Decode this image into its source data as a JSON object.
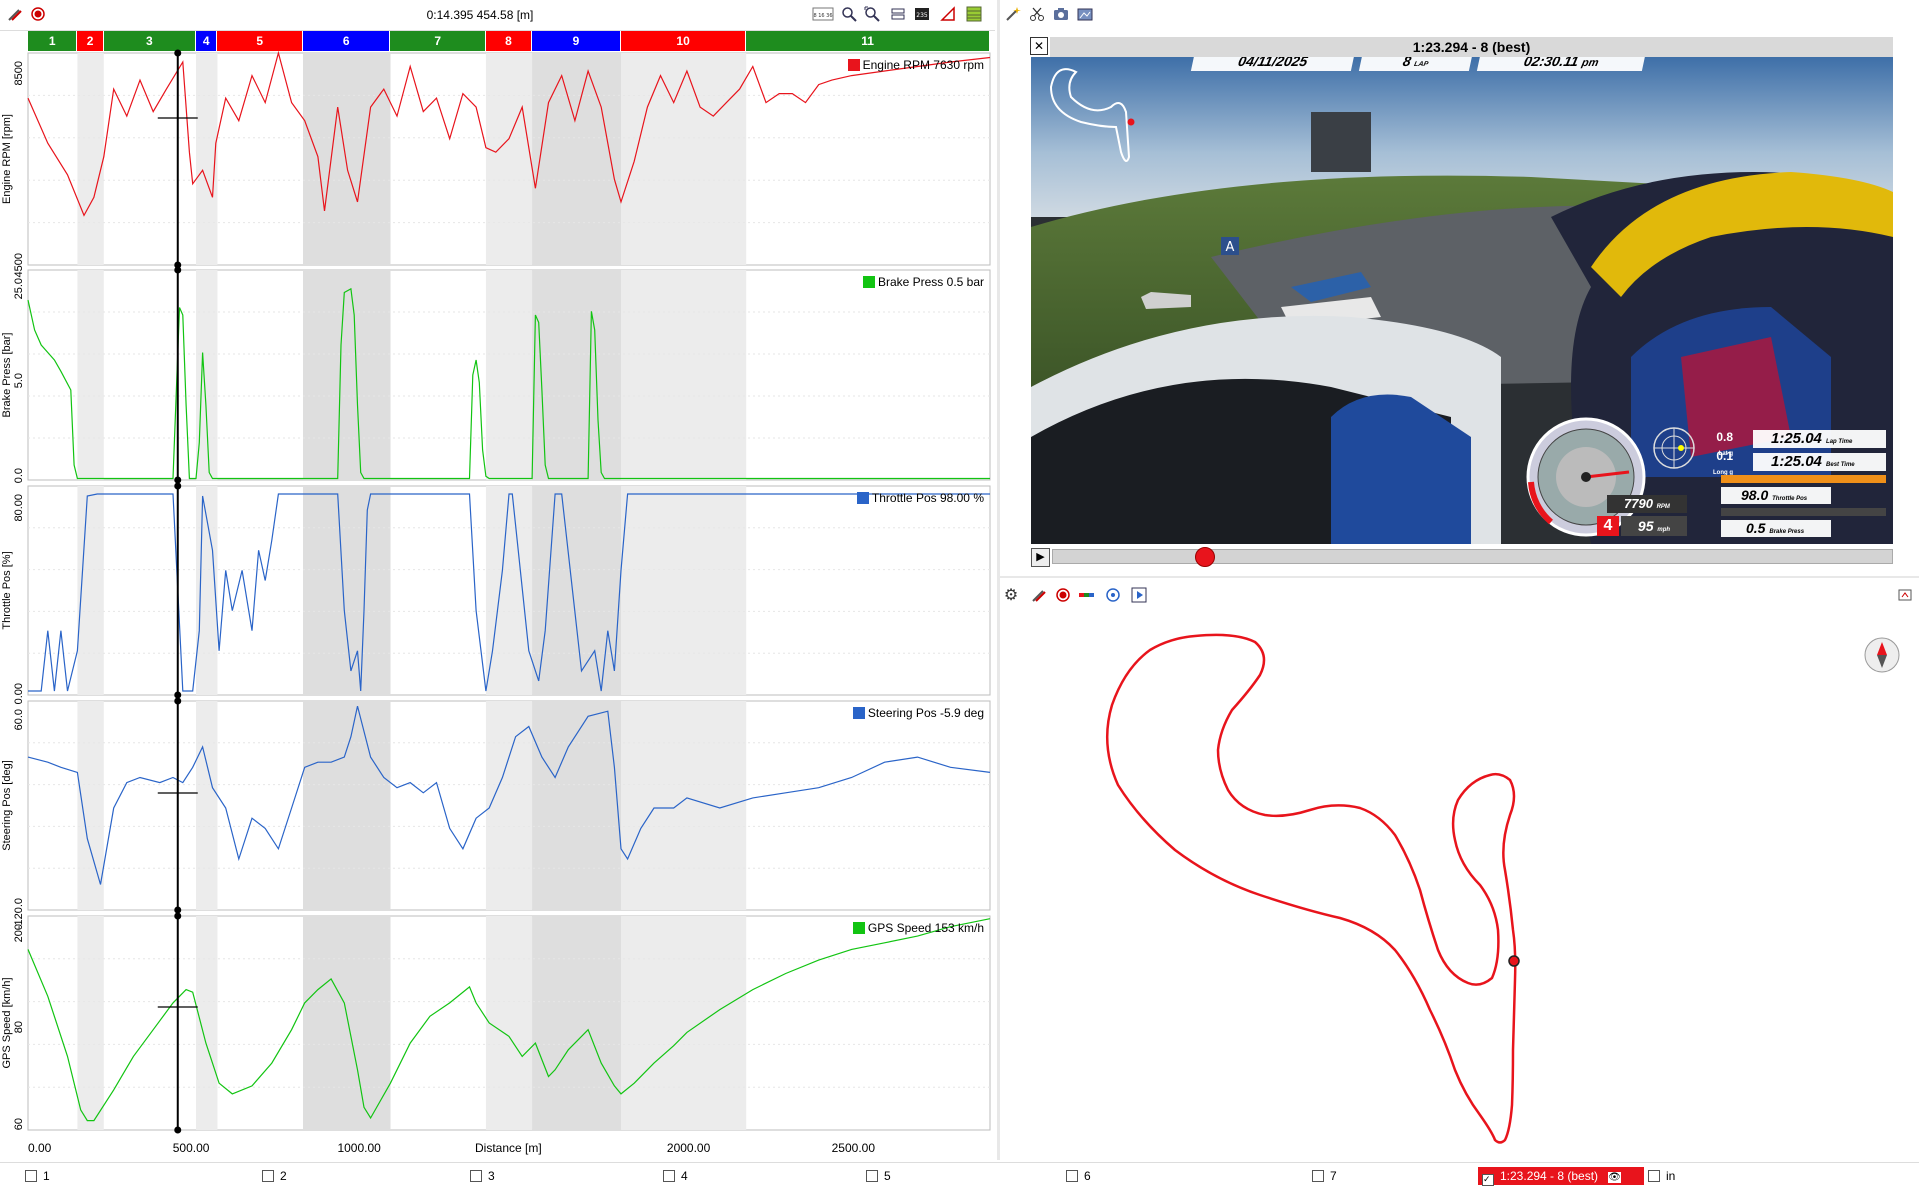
{
  "toolbar": {
    "cursor_readout": "0:14.395 454.58 [m]",
    "icons": [
      "tools-icon",
      "record-icon",
      "time-format-icon",
      "zoom-in-icon",
      "zoom-fit-icon",
      "layout-icon",
      "channels-icon",
      "marker-icon",
      "grid-icon"
    ],
    "time_format_label": "8 16 36",
    "channels_badge": "235"
  },
  "sectors": [
    {
      "label": "1",
      "color": "#1e8c1e"
    },
    {
      "label": "2",
      "color": "#ff0000"
    },
    {
      "label": "3",
      "color": "#1e8c1e"
    },
    {
      "label": "4",
      "color": "#0000ff"
    },
    {
      "label": "5",
      "color": "#ff0000"
    },
    {
      "label": "6",
      "color": "#0000ff"
    },
    {
      "label": "7",
      "color": "#1e8c1e"
    },
    {
      "label": "8",
      "color": "#ff0000"
    },
    {
      "label": "9",
      "color": "#0000ff"
    },
    {
      "label": "10",
      "color": "#ff0000"
    },
    {
      "label": "11",
      "color": "#1e8c1e"
    }
  ],
  "channels": [
    {
      "name": "Engine RPM",
      "value": "7630",
      "unit": "rpm",
      "ylabel": "Engine RPM [rpm]",
      "ticks": [
        "8500",
        "4500"
      ],
      "color": "#e8141c"
    },
    {
      "name": "Brake Press",
      "value": "0.5",
      "unit": "bar",
      "ylabel": "Brake Press [bar]",
      "ticks": [
        "25.0",
        "5.0",
        "0.0"
      ],
      "color": "#12c412"
    },
    {
      "name": "Throttle Pos",
      "value": "98.00",
      "unit": "%",
      "ylabel": "Throttle Pos [%]",
      "ticks": [
        "80.00",
        "0.00"
      ],
      "color": "#2a64c8"
    },
    {
      "name": "Steering Pos",
      "value": "-5.9",
      "unit": "deg",
      "ylabel": "Steering Pos [deg]",
      "ticks": [
        "60.0",
        "-120.0"
      ],
      "color": "#2a64c8"
    },
    {
      "name": "GPS Speed",
      "value": "153",
      "unit": "km/h",
      "ylabel": "GPS Speed [km/h]",
      "ticks": [
        "200",
        "80",
        "60"
      ],
      "color": "#12c412"
    }
  ],
  "x_axis": {
    "label": "Distance [m]",
    "ticks": [
      "0.00",
      "500.00",
      "1000.00",
      "2000.00",
      "2500.00"
    ]
  },
  "video": {
    "title": "1:23.294 - 8 (best)",
    "date": "04/11/2025",
    "lap_number": "8",
    "lap_word": "LAP",
    "clock": "02:30.11",
    "clock_suffix": "pm",
    "lap_time": "1:25.04",
    "lap_time_label": "Lap Time",
    "best_time": "1:25.04",
    "best_time_label": "Best Time",
    "lat_g": "0.8",
    "lat_label": "Lat g",
    "long_g": "0.1",
    "long_label": "Long g",
    "throttle": "98.0",
    "throttle_label": "Throttle Pos",
    "brake": "0.5",
    "brake_label": "Brake Press",
    "rpm": "7790",
    "rpm_unit": "RPM",
    "gear": "4",
    "speed": "95",
    "speed_unit": "mph",
    "track_sign": "A",
    "close_label": "✕",
    "play_label": "▶",
    "scrub_fraction": 0.18
  },
  "map_toolbar": {
    "icons": [
      "gear-icon",
      "tools-icon",
      "record-icon",
      "color-bar-icon",
      "target-icon",
      "play-icon",
      "export-icon"
    ]
  },
  "footer": {
    "slots": [
      "1",
      "2",
      "3",
      "4",
      "5",
      "6",
      "7"
    ],
    "active_lap": "1:23.294 - 8 (best)",
    "last_slot": "in"
  },
  "chart_data": [
    {
      "type": "line",
      "title": "Engine RPM",
      "ylabel": "Engine RPM [rpm]",
      "xlabel": "Distance [m]",
      "xlim": [
        0,
        2920
      ],
      "ylim": [
        4200,
        8900
      ],
      "x": [
        0,
        60,
        120,
        170,
        200,
        230,
        260,
        300,
        340,
        380,
        420,
        470,
        490,
        500,
        530,
        560,
        570,
        600,
        640,
        680,
        720,
        760,
        800,
        840,
        880,
        900,
        940,
        970,
        1000,
        1040,
        1080,
        1120,
        1160,
        1200,
        1240,
        1280,
        1320,
        1360,
        1390,
        1420,
        1460,
        1500,
        1540,
        1580,
        1620,
        1660,
        1700,
        1740,
        1780,
        1800,
        1840,
        1880,
        1920,
        1960,
        2000,
        2040,
        2080,
        2120,
        2160,
        2200,
        2240,
        2280,
        2320,
        2360,
        2400,
        2440,
        2500,
        2600,
        2700,
        2800,
        2920
      ],
      "values": [
        7900,
        6900,
        6200,
        5300,
        5700,
        6600,
        8100,
        7500,
        8300,
        7600,
        8100,
        8700,
        6700,
        6000,
        6300,
        5700,
        6900,
        7900,
        7400,
        8400,
        7800,
        8900,
        7800,
        7400,
        6600,
        5400,
        7700,
        6300,
        5600,
        7700,
        8100,
        7500,
        8600,
        7600,
        7900,
        7000,
        8000,
        7700,
        6800,
        6700,
        7000,
        7700,
        5900,
        7800,
        8400,
        7400,
        8500,
        7700,
        6100,
        5600,
        6500,
        7700,
        8400,
        7800,
        8500,
        7700,
        7500,
        7800,
        8100,
        8600,
        7800,
        8000,
        8000,
        7800,
        8200,
        8300,
        8400,
        8500,
        8600,
        8700,
        8800
      ]
    },
    {
      "type": "line",
      "title": "Brake Press",
      "ylabel": "Brake Press [bar]",
      "xlabel": "Distance [m]",
      "xlim": [
        0,
        2920
      ],
      "ylim": [
        0,
        28
      ],
      "x": [
        0,
        20,
        40,
        60,
        80,
        100,
        130,
        140,
        150,
        440,
        460,
        470,
        480,
        490,
        500,
        510,
        520,
        530,
        540,
        550,
        560,
        570,
        580,
        940,
        950,
        960,
        980,
        990,
        1000,
        1010,
        1020,
        1340,
        1350,
        1360,
        1370,
        1380,
        1390,
        1400,
        1530,
        1540,
        1550,
        1560,
        1570,
        1580,
        1700,
        1710,
        1720,
        1730,
        1740,
        1750,
        1760,
        2920
      ],
      "values": [
        24.0,
        20.0,
        18.0,
        17.0,
        16.0,
        14.5,
        12.0,
        2.0,
        0.2,
        0.2,
        23.0,
        22.0,
        10.0,
        0.2,
        0.2,
        0.2,
        5.0,
        17.0,
        10.0,
        1.0,
        0.2,
        0.2,
        0.2,
        0.2,
        18.0,
        25.0,
        25.5,
        22.0,
        10.0,
        1.0,
        0.2,
        0.2,
        14.0,
        16.0,
        13.0,
        4.0,
        0.5,
        0.2,
        0.2,
        22.0,
        21.0,
        12.0,
        2.0,
        0.2,
        0.2,
        22.5,
        20.0,
        8.0,
        1.0,
        0.2,
        0.2,
        0.2
      ]
    },
    {
      "type": "line",
      "title": "Throttle Pos",
      "ylabel": "Throttle Pos [%]",
      "xlabel": "Distance [m]",
      "xlim": [
        0,
        2920
      ],
      "ylim": [
        -2,
        102
      ],
      "x": [
        0,
        40,
        60,
        80,
        100,
        120,
        150,
        180,
        210,
        440,
        470,
        500,
        520,
        530,
        560,
        580,
        600,
        620,
        650,
        680,
        700,
        720,
        740,
        760,
        940,
        960,
        980,
        1000,
        1010,
        1020,
        1030,
        1040,
        1340,
        1360,
        1390,
        1410,
        1440,
        1460,
        1470,
        1520,
        1550,
        1570,
        1600,
        1620,
        1680,
        1720,
        1740,
        1760,
        1780,
        1800,
        1820,
        2920
      ],
      "values": [
        0,
        0,
        30,
        0,
        30,
        0,
        20,
        97,
        98,
        98,
        0,
        0,
        30,
        97,
        70,
        20,
        60,
        40,
        60,
        30,
        70,
        55,
        75,
        98,
        98,
        40,
        10,
        20,
        0,
        40,
        90,
        98,
        98,
        40,
        0,
        20,
        60,
        98,
        98,
        20,
        5,
        30,
        98,
        98,
        10,
        20,
        0,
        30,
        10,
        60,
        98,
        98
      ]
    },
    {
      "type": "line",
      "title": "Steering Pos",
      "ylabel": "Steering Pos [deg]",
      "xlabel": "Distance [m]",
      "xlim": [
        0,
        2920
      ],
      "ylim": [
        -130,
        75
      ],
      "x": [
        0,
        60,
        100,
        150,
        180,
        220,
        260,
        300,
        340,
        400,
        440,
        470,
        500,
        530,
        560,
        600,
        640,
        680,
        720,
        760,
        800,
        840,
        880,
        920,
        960,
        980,
        1000,
        1040,
        1080,
        1120,
        1160,
        1200,
        1240,
        1280,
        1320,
        1360,
        1400,
        1440,
        1480,
        1520,
        1560,
        1600,
        1640,
        1700,
        1760,
        1780,
        1800,
        1820,
        1860,
        1900,
        1960,
        2000,
        2100,
        2200,
        2300,
        2400,
        2500,
        2600,
        2700,
        2800,
        2920
      ],
      "values": [
        20,
        15,
        10,
        5,
        -60,
        -105,
        -30,
        -5,
        0,
        -5,
        0,
        -5,
        10,
        30,
        -10,
        -30,
        -80,
        -40,
        -50,
        -70,
        -30,
        10,
        15,
        15,
        20,
        40,
        70,
        20,
        0,
        -10,
        -5,
        -15,
        -5,
        -50,
        -70,
        -40,
        -30,
        0,
        40,
        50,
        20,
        0,
        30,
        60,
        65,
        10,
        -70,
        -80,
        -50,
        -30,
        -30,
        -20,
        -30,
        -20,
        -15,
        -10,
        0,
        15,
        20,
        10,
        5
      ]
    },
    {
      "type": "line",
      "title": "GPS Speed",
      "ylabel": "GPS Speed [km/h]",
      "xlabel": "Distance [m]",
      "xlim": [
        0,
        2920
      ],
      "ylim": [
        55,
        215
      ],
      "x": [
        0,
        60,
        120,
        160,
        180,
        200,
        260,
        320,
        380,
        440,
        480,
        500,
        540,
        580,
        620,
        680,
        740,
        800,
        840,
        880,
        920,
        960,
        1000,
        1020,
        1040,
        1100,
        1160,
        1220,
        1280,
        1340,
        1360,
        1400,
        1460,
        1500,
        1540,
        1580,
        1600,
        1640,
        1700,
        1740,
        1780,
        1800,
        1840,
        1900,
        1960,
        2000,
        2100,
        2200,
        2300,
        2400,
        2500,
        2600,
        2700,
        2800,
        2920
      ],
      "values": [
        190,
        155,
        110,
        70,
        62,
        62,
        85,
        110,
        130,
        150,
        160,
        158,
        120,
        90,
        82,
        88,
        105,
        130,
        150,
        160,
        168,
        150,
        100,
        72,
        64,
        90,
        120,
        140,
        150,
        162,
        150,
        135,
        125,
        110,
        120,
        95,
        100,
        115,
        130,
        105,
        88,
        82,
        90,
        105,
        118,
        128,
        145,
        160,
        172,
        182,
        190,
        195,
        200,
        207,
        213
      ]
    }
  ]
}
